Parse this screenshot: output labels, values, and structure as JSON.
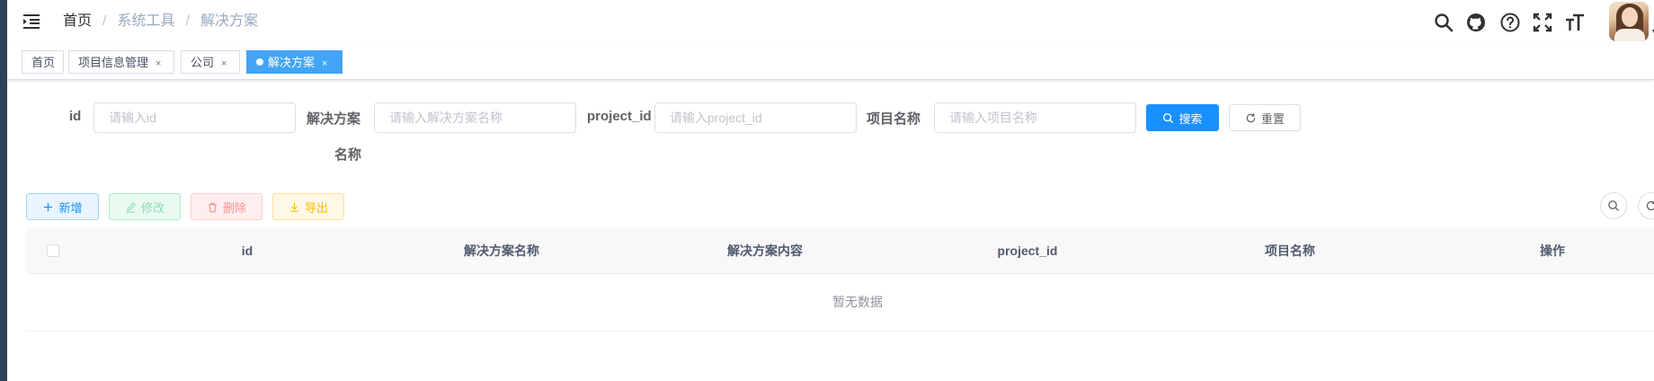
{
  "navbar": {
    "breadcrumbs": [
      "首页",
      "系统工具",
      "解决方案"
    ],
    "separator": "/",
    "icons": [
      "search-icon",
      "github-icon",
      "question-icon",
      "fullscreen-icon",
      "font-size-icon"
    ]
  },
  "tags": [
    {
      "label": "首页",
      "active": false,
      "closable": false
    },
    {
      "label": "项目信息管理",
      "active": false,
      "closable": true
    },
    {
      "label": "公司",
      "active": false,
      "closable": true
    },
    {
      "label": "解决方案",
      "active": true,
      "closable": true
    }
  ],
  "tag_close_glyph": "×",
  "search_form": {
    "id_label": "id",
    "id_placeholder": "请输入id",
    "name_label_line1": "解决方案",
    "name_label_line2": "名称",
    "name_placeholder": "请输入解决方案名称",
    "project_id_label": "project_id",
    "project_id_placeholder": "请输入project_id",
    "project_name_label": "项目名称",
    "project_name_placeholder": "请输入项目名称",
    "search_button": "搜索",
    "reset_button": "重置"
  },
  "toolbar": {
    "add": "新增",
    "edit": "修改",
    "delete": "删除",
    "export": "导出"
  },
  "table": {
    "columns": [
      "id",
      "解决方案名称",
      "解决方案内容",
      "project_id",
      "项目名称",
      "操作"
    ],
    "empty_text": "暂无数据"
  },
  "colors": {
    "primary": "#1890ff",
    "active_tag": "#42a5f5",
    "sidebar": "#304156"
  }
}
